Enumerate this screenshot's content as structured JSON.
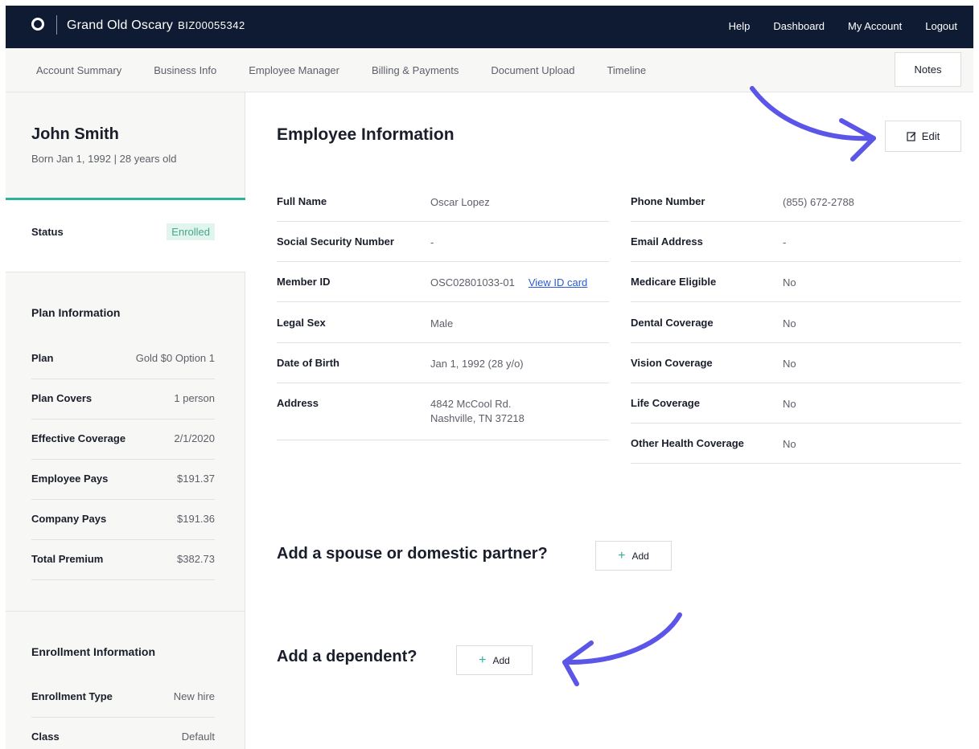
{
  "topbar": {
    "brand": "Grand Old Oscary",
    "biz_id": "BIZ00055342",
    "nav": [
      "Help",
      "Dashboard",
      "My Account",
      "Logout"
    ]
  },
  "tabs": [
    "Account Summary",
    "Business Info",
    "Employee Manager",
    "Billing & Payments",
    "Document Upload",
    "Timeline"
  ],
  "notes_label": "Notes",
  "sidebar": {
    "name": "John Smith",
    "born": "Born Jan 1, 1992 | 28 years old",
    "status_label": "Status",
    "status_value": "Enrolled",
    "plan_heading": "Plan Information",
    "plan_rows": [
      {
        "k": "Plan",
        "v": "Gold $0 Option 1"
      },
      {
        "k": "Plan Covers",
        "v": "1 person"
      },
      {
        "k": "Effective Coverage",
        "v": "2/1/2020"
      },
      {
        "k": "Employee Pays",
        "v": "$191.37"
      },
      {
        "k": "Company Pays",
        "v": "$191.36"
      },
      {
        "k": "Total Premium",
        "v": "$382.73"
      }
    ],
    "enroll_heading": "Enrollment Information",
    "enroll_rows": [
      {
        "k": "Enrollment Type",
        "v": "New hire"
      },
      {
        "k": "Class",
        "v": "Default"
      }
    ]
  },
  "main": {
    "title": "Employee Information",
    "edit_label": "Edit",
    "left_rows": [
      {
        "k": "Full Name",
        "v": "Oscar Lopez"
      },
      {
        "k": "Social Security Number",
        "v": "-"
      },
      {
        "k": "Member ID",
        "v": "OSC02801033-01",
        "link": "View ID card"
      },
      {
        "k": "Legal Sex",
        "v": "Male"
      },
      {
        "k": "Date of Birth",
        "v": "Jan 1, 1992 (28 y/o)"
      },
      {
        "k": "Address",
        "v": "4842 McCool Rd.",
        "v2": "Nashville, TN 37218"
      }
    ],
    "right_rows": [
      {
        "k": "Phone Number",
        "v": "(855) 672-2788"
      },
      {
        "k": "Email Address",
        "v": "-"
      },
      {
        "k": "Medicare Eligible",
        "v": "No"
      },
      {
        "k": "Dental Coverage",
        "v": "No"
      },
      {
        "k": "Vision Coverage",
        "v": "No"
      },
      {
        "k": "Life Coverage",
        "v": "No"
      },
      {
        "k": "Other Health Coverage",
        "v": "No"
      }
    ],
    "spouse_question": "Add a spouse or domestic partner?",
    "dependent_question": "Add a dependent?",
    "add_label": "Add"
  },
  "colors": {
    "accent": "#2bb29a",
    "topbar": "#0f1b33",
    "link": "#2b5bd7",
    "arrow": "#5b55e8"
  }
}
